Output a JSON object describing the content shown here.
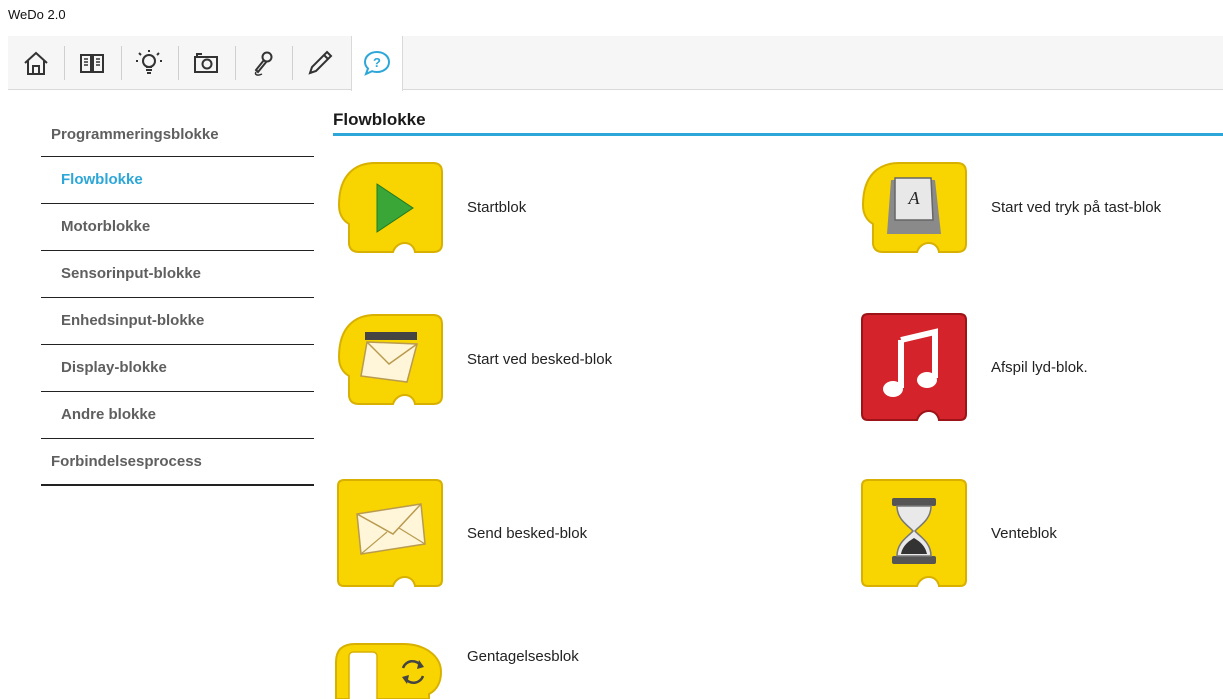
{
  "app": {
    "title": "WeDo 2.0"
  },
  "toolbar": {
    "buttons": [
      {
        "name": "home-icon"
      },
      {
        "name": "book-icon"
      },
      {
        "name": "lightbulb-icon"
      },
      {
        "name": "camera-icon"
      },
      {
        "name": "microphone-icon"
      },
      {
        "name": "pencil-icon"
      },
      {
        "name": "help-bubble-icon"
      }
    ],
    "accent": "#2da7d8"
  },
  "sidebar": {
    "heading": "Programmeringsblokke",
    "items": [
      {
        "label": "Flowblokke",
        "active": true
      },
      {
        "label": "Motorblokke"
      },
      {
        "label": "Sensorinput-blokke"
      },
      {
        "label": "Enhedsinput-blokke"
      },
      {
        "label": "Display-blokke"
      },
      {
        "label": "Andre blokke"
      }
    ],
    "footer": "Forbindelsesprocess"
  },
  "main": {
    "title": "Flowblokke",
    "blocks": [
      {
        "label": "Startblok",
        "icon": "play-icon"
      },
      {
        "label": "Start ved tryk på tast-blok",
        "icon": "keyboard-key-icon"
      },
      {
        "label": "Start ved besked-blok",
        "icon": "open-envelope-icon"
      },
      {
        "label": "Afspil lyd-blok.",
        "icon": "music-note-icon"
      },
      {
        "label": "Send besked-blok",
        "icon": "envelope-icon"
      },
      {
        "label": "Venteblok",
        "icon": "hourglass-icon"
      },
      {
        "label": "Gentagelsesblok",
        "icon": "loop-icon"
      }
    ],
    "colors": {
      "yellow": "#f8d400",
      "red": "#d4232a"
    }
  }
}
